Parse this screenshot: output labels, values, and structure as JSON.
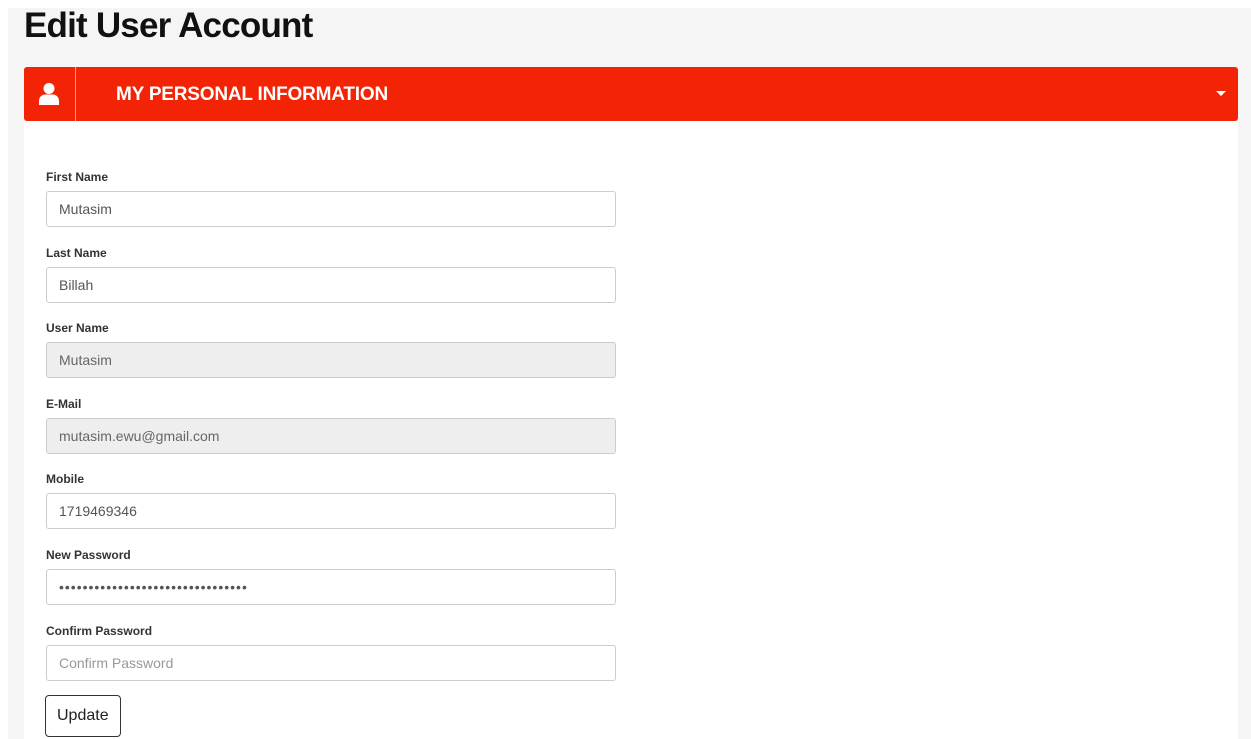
{
  "page": {
    "title": "Edit User Account"
  },
  "panel": {
    "title": "MY PERSONAL INFORMATION",
    "icon": "user-icon",
    "toggle_icon": "caret-down-icon",
    "header_color": "#f22405"
  },
  "form": {
    "first_name": {
      "label": "First Name",
      "value": "Mutasim"
    },
    "last_name": {
      "label": "Last Name",
      "value": "Billah"
    },
    "user_name": {
      "label": "User Name",
      "value": "Mutasim",
      "readonly": true
    },
    "email": {
      "label": "E-Mail",
      "value": "mutasim.ewu@gmail.com",
      "readonly": true
    },
    "mobile": {
      "label": "Mobile",
      "value": "1719469346"
    },
    "new_password": {
      "label": "New Password",
      "value": "••••••••••••••••••••••••••••••••"
    },
    "confirm_password": {
      "label": "Confirm Password",
      "placeholder": "Confirm Password",
      "value": ""
    },
    "update_label": "Update"
  }
}
